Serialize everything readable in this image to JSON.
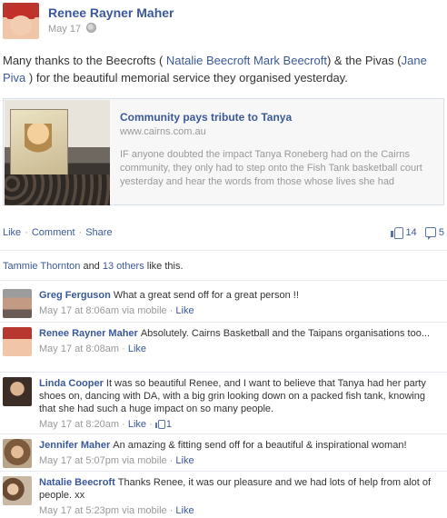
{
  "post": {
    "author": "Renee Rayner Maher",
    "date": "May 17",
    "privacy_icon": "globe-icon",
    "message": {
      "prefix": "Many thanks to the Beecrofts ( ",
      "tag1": "Natalie Beecroft",
      "space": " ",
      "tag2": "Mark Beecroft",
      "mid": ") & the Pivas (",
      "tag3": "Jane Piva",
      "suffix": " ) for the beautiful memorial service they organised yesterday."
    },
    "link_preview": {
      "title": "Community pays tribute to Tanya",
      "domain": "www.cairns.com.au",
      "description": "IF anyone doubted the impact Tanya Roneberg had on the Cairns community, they only had to step onto the Fish Tank basketball court yesterday and hear the words from those whose lives she had"
    },
    "actions": {
      "like": "Like",
      "comment": "Comment",
      "share": "Share",
      "separator": "·"
    },
    "counts": {
      "likes": "14",
      "comments": "5"
    },
    "likes_summary": {
      "first": "Tammie Thornton",
      "and": " and ",
      "others": "13 others",
      "suffix": " like this."
    }
  },
  "comments": [
    {
      "name": "Greg Ferguson",
      "text": "What a great send off for a great person !!",
      "time": "May 17 at 8:06am via mobile",
      "like": "Like"
    },
    {
      "name": "Renee Rayner Maher",
      "text": "Absolutely. Cairns Basketball and the Taipans organisations too...",
      "time": "May 17 at 8:08am",
      "like": "Like"
    },
    {
      "name": "Linda Cooper",
      "text": "It was so beautiful Renee, and I want to believe that Tanya had her party shoes on, dancing with DA, with a big grin looking down on a packed fish tank, knowing that she had such a huge impact on so many people.",
      "time": "May 17 at 8:20am",
      "like": "Like",
      "like_count": "1"
    },
    {
      "name": "Jennifer Maher",
      "text": "An amazing & fitting send off for a beautiful & inspirational woman!",
      "time": "May 17 at 5:07pm via mobile",
      "like": "Like"
    },
    {
      "name": "Natalie Beecroft",
      "text": "Thanks Renee, it was our pleasure and we had lots of help from alot of people. xx",
      "time": "May 17 at 5:23pm via mobile",
      "like": "Like"
    }
  ],
  "colors": {
    "link": "#3b5998",
    "muted": "#999999",
    "text": "#333333",
    "divider": "#e5eaf1"
  }
}
